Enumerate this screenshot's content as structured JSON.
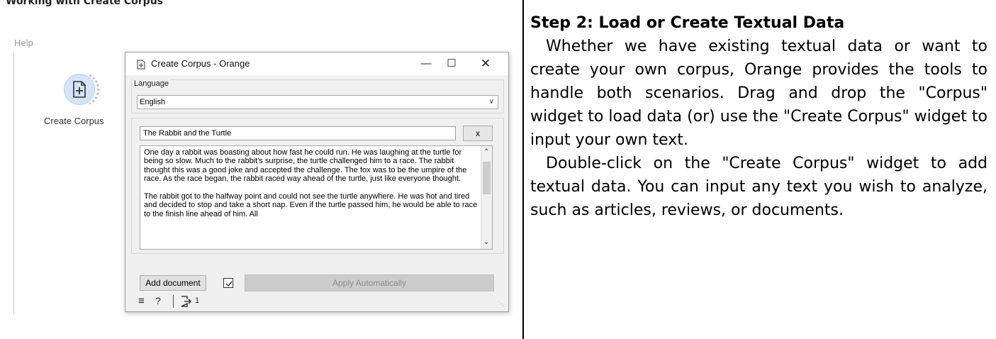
{
  "left": {
    "cut_header": "Working with Create Corpus",
    "help_menu": "Help",
    "widget_label": "Create Corpus"
  },
  "dialog": {
    "title": "Create Corpus - Orange",
    "min_label": "—",
    "max_label": "☐",
    "close_label": "✕",
    "language_legend": "Language",
    "language_value": "English",
    "doc_title": "The Rabbit and the Turtle",
    "remove_label": "x",
    "doc_text": "One day a rabbit was boasting about how fast he could run. He was laughing at the turtle for being so slow. Much to the rabbit's surprise, the turtle challenged him to a race. The rabbit thought this was a good joke and accepted the challenge. The fox was to be the umpire of the race. As the race began, the rabbit raced way ahead of the turtle, just like everyone thought.\n\nThe rabbit got to the halfway point and could not see the turtle anywhere. He was hot and tired and decided to stop and take a short nap. Even if the turtle passed him, he would be able to race to the finish line ahead of him. All",
    "add_document_label": "Add document",
    "apply_label": "Apply Automatically",
    "status_output_count": "1"
  },
  "right": {
    "heading": "Step 2: Load or Create Textual Data",
    "para1": "Whether we have existing textual data or want to create your own corpus, Orange provides the tools to handle both scenarios. Drag and drop the \"Corpus\" widget to load data (or) use the \"Create Corpus\" widget to input your own text.",
    "para2": "Double-click on the \"Create Corpus\" widget to add textual data. You can input any text you wish to analyze, such as articles, reviews, or documents."
  },
  "icons": [
    "create-corpus-icon",
    "document-plus-icon",
    "minimize-icon",
    "maximize-icon",
    "close-icon",
    "chevron-down-icon",
    "hamburger-menu-icon",
    "help-icon",
    "output-icon",
    "checkbox-checked-icon"
  ],
  "colors": {
    "widget_circle": "#d5e4f7",
    "dialog_bg": "#f0f0f0",
    "apply_disabled": "#cccccc"
  }
}
